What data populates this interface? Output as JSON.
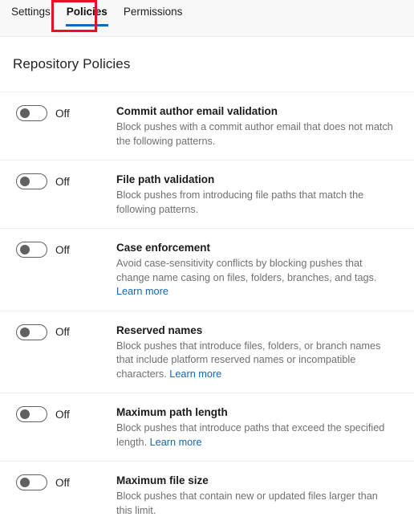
{
  "tabs": [
    {
      "label": "Settings",
      "active": false
    },
    {
      "label": "Policies",
      "active": true
    },
    {
      "label": "Permissions",
      "active": false
    }
  ],
  "highlight": {
    "color": "#e81123",
    "target_tab": "Policies"
  },
  "accent_color": "#0f6cbd",
  "link_color": "#1765ad",
  "page": {
    "title": "Repository Policies"
  },
  "policies": [
    {
      "state_label": "Off",
      "enabled": false,
      "title": "Commit author email validation",
      "description": "Block pushes with a commit author email that does not match the following patterns.",
      "link_text": ""
    },
    {
      "state_label": "Off",
      "enabled": false,
      "title": "File path validation",
      "description": "Block pushes from introducing file paths that match the following patterns.",
      "link_text": ""
    },
    {
      "state_label": "Off",
      "enabled": false,
      "title": "Case enforcement",
      "description": "Avoid case-sensitivity conflicts by blocking pushes that change name casing on files, folders, branches, and tags.",
      "link_text": "Learn more"
    },
    {
      "state_label": "Off",
      "enabled": false,
      "title": "Reserved names",
      "description": "Block pushes that introduce files, folders, or branch names that include platform reserved names or incompatible characters.",
      "link_text": "Learn more"
    },
    {
      "state_label": "Off",
      "enabled": false,
      "title": "Maximum path length",
      "description": "Block pushes that introduce paths that exceed the specified length.",
      "link_text": "Learn more"
    },
    {
      "state_label": "Off",
      "enabled": false,
      "title": "Maximum file size",
      "description": "Block pushes that contain new or updated files larger than this limit.",
      "link_text": ""
    }
  ]
}
